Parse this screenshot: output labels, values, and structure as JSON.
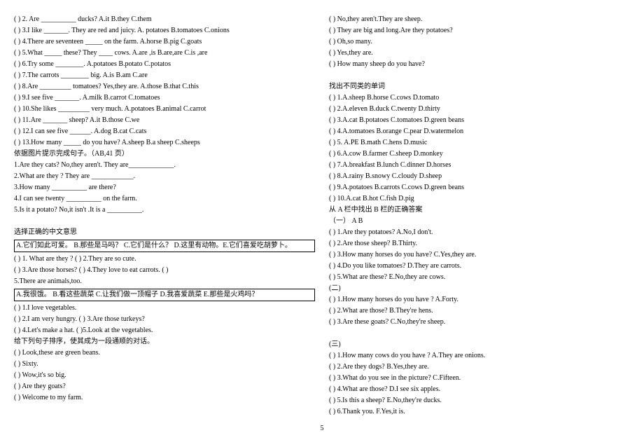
{
  "left": {
    "q2": "(        ) 2. Are __________ ducks? A.it  B.they  C.them",
    "q3": "(       ) 3.I like _______. They are red and juicy. A. potatoes  B.tomatoes C.onions",
    "q4": "(     ) 4.There are seventeen _____ on the farm. A.horse  B.pig  C.goats",
    "q5": "(     ) 5.What _____ these? They ____ cows. A.are ,is  B.are,are  C.is ,are",
    "q6": "(     ) 6.Try some ________. A.potatoes  B.potato  C.potatos",
    "q7": "(     ) 7.The carrots ________ big. A.is  B.am  C.are",
    "q8": "(     ) 8.Are _________ tomatoes? Yes,they are.  A.those  B.that  C.this",
    "q9": "(     ) 9.I see five _______. A.milk  B.carrot  C.tomatoes",
    "q10": "(     ) 10.She likes _________ very much. A.potatoes  B.animal  C.carrot",
    "q11": "(     ) 11.Are _______ sheep? A.it  B.those  C.we",
    "q12": "(     ) 12.I can see five ______. A.dog  B.cat  C.cats",
    "q13": "(     ) 13.How many _____ do you have?  A.sheep  B.a sheep  C.sheeps",
    "s1_title": "依据图片提示完成句子。（AB,41 页）",
    "s1_1": "1.Are they cats? No,they aren't. They are_____________.",
    "s1_2": "2.What are they ? They are ____________.",
    "s1_3": "3.How many __________ are there?",
    "s1_4": "4.I can see twenty __________ on the farm.",
    "s1_5": "5.Is it a potato? No,it isn't .It is a __________.",
    "s2_title": "选择正确的中文意思",
    "s2_box1": "A.它们如此可爱。  B.那些是马吗？  C.它们是什么？  D.这里有动物。E.它们喜爱吃胡萝卜。",
    "s2_1": "(       ) 1. What are they ?  (        ) 2.They are so cute.",
    "s2_3": "(       ) 3.Are those horses?  (       ) 4.They love to eat carrots.  (      )",
    "s2_5": "5.There are animals,too.",
    "s2_box2": "A.我很饿。 B.看这些蔬菜  C.让我们做一顶帽子  D.我喜爱蔬菜 E.那些是火鸡吗？",
    "s2_b1": "(       ) 1.I love vegetables.",
    "s2_b2": "(       ) 2.I am very hungry.   (        ) 3.Are those turkeys?",
    "s2_b4": "(       ) 4.Let's make a hat.  (       )5.Look at the vegetables.",
    "s3_title": "给下列句子排序，使其成为一段通顺的对话。",
    "s3_1": "(       ) Look,these are green beans.",
    "s3_2": "(       ) Sixty.",
    "s3_3": "(       ) Wow,it's so big.",
    "s3_4": "(       ) Are they goats?",
    "s3_5": "(       ) Welcome to my farm."
  },
  "right": {
    "c1": "(       ) No,they aren't.They are sheep.",
    "c2": "(       ) They are big and long.Are they potatoes?",
    "c3": "(       ) Oh,so many.",
    "c4": "(       ) Yes,they are.",
    "c5": "(       ) How many sheep do you have?",
    "d_title": "找出不同类的单词",
    "d1": "(       ) 1.A.sheep  B.horse  C.cows  D.tomato",
    "d2": "(       ) 2.A.eleven  B.duck  C.twenty  D.thirty",
    "d3": "(       ) 3.A.cat  B.potatoes  C.tomatoes  D.green beans",
    "d4": "(       ) 4.A.tomatoes  B.orange  C.pear   D.watermelon",
    "d5": "(       ) 5. A.PE  B.math  C.hens  D.music",
    "d6": "(       ) 6.A.cow  B.farmer  C.sheep  D.monkey",
    "d7": "(       ) 7.A.breakfast   B.lunch  C.dinner  D.horses",
    "d8": "(       ) 8.A.rainy  B.snowy  C.cloudy  D.sheep",
    "d9": "(       ) 9.A.potatoes  B.carrots  C.cows  D.green beans",
    "d10": "(       ) 10.A.cat  B.hot  C.fish  D.pig",
    "m_title": "从 A 栏中找出 B 栏的正确答案",
    "m1_label": "（一）    A                                       B",
    "m1_1": "       (       ) 1.Are they potatoes?  A.No,I don't.",
    "m1_2": "       (       ) 2.Are those sheep?      B.Thirty.",
    "m1_3": "(       ) 3.How many horses do you have?  C.Yes,they are.",
    "m1_4": "(       ) 4.Do you like tomatoes?   D.They are carrots.",
    "m1_5": "(       ) 5.What are these?       E.No,they are cows.",
    "m2_label": "(二)",
    "m2_1": "(       ) 1.How many horses do you have ?   A.Forty.",
    "m2_2": "(       ) 2.What are those?            B.They're hens.",
    "m2_3": "(       ) 3.Are these goats?                  C.No,they're sheep.",
    "m3_label": "(三)",
    "m3_1": "(       ) 1.How many cows do you have ?   A.They are onions.",
    "m3_2": "(       ) 2.Are they dogs?                            B.Yes,they are.",
    "m3_3": "(       ) 3.What do you see in the picture?  C.Fifteen.",
    "m3_4": "(       ) 4.What are those?     D.I see six apples.",
    "m3_5": "(       ) 5.Is this a sheep?    E.No,they're ducks.",
    "m3_6": "(       ) 6.Thank you.     F.Yes,it is."
  },
  "page_number": "5"
}
